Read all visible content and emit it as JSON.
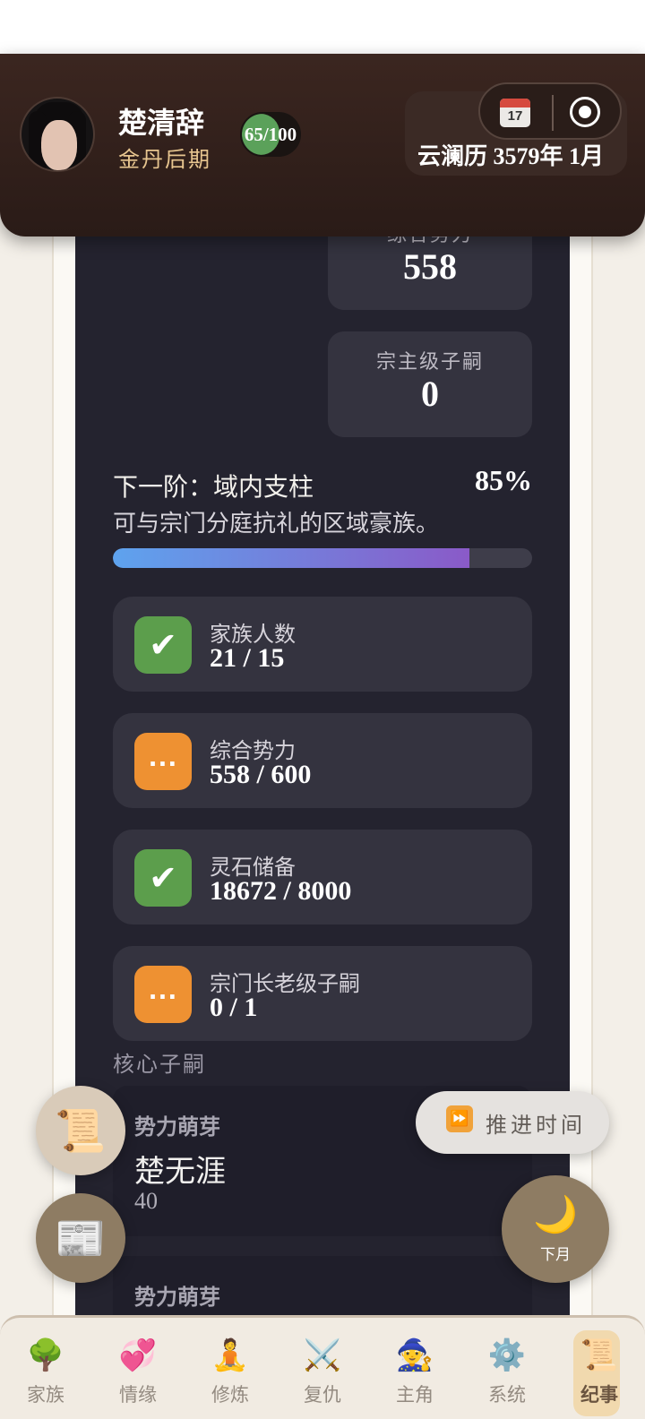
{
  "header": {
    "name": "楚清辞",
    "realm": "金丹后期",
    "hp_text": "65/100",
    "hp_fraction": 0.65,
    "date": "云澜历 3579年 1月",
    "calendar_day": "17"
  },
  "stats": {
    "power_label": "综合势力",
    "power_value": "558",
    "sect_master_heirs_label": "宗主级子嗣",
    "sect_master_heirs_value": "0"
  },
  "next_tier": {
    "title": "下一阶：域内支柱",
    "percent_text": "85%",
    "percent": 85,
    "description": "可与宗门分庭抗礼的区域豪族。"
  },
  "requirements": [
    {
      "label": "家族人数",
      "value": "21 / 15",
      "status": "done",
      "badge": "✔"
    },
    {
      "label": "综合势力",
      "value": "558 / 600",
      "status": "pending",
      "badge": "..."
    },
    {
      "label": "灵石储备",
      "value": "18672 / 8000",
      "status": "done",
      "badge": "✔"
    },
    {
      "label": "宗门长老级子嗣",
      "value": "0 / 1",
      "status": "pending",
      "badge": "..."
    }
  ],
  "core_heirs": {
    "section_label": "核心子嗣",
    "cards": [
      {
        "tag": "势力萌芽",
        "name": "楚无涯",
        "value": "40"
      },
      {
        "tag": "势力萌芽"
      }
    ]
  },
  "floating": {
    "scroll_icon": "📜",
    "news_icon": "📰",
    "advance_label": "推进时间",
    "next_month_label": "下月"
  },
  "nav": {
    "items": [
      {
        "label": "家族",
        "icon": "tree-icon"
      },
      {
        "label": "情缘",
        "icon": "hearts-icon"
      },
      {
        "label": "修炼",
        "icon": "meditation-icon"
      },
      {
        "label": "复仇",
        "icon": "swords-icon"
      },
      {
        "label": "主角",
        "icon": "mage-icon"
      },
      {
        "label": "系统",
        "icon": "gear-icon"
      },
      {
        "label": "纪事",
        "icon": "scroll-icon",
        "active": true
      }
    ]
  }
}
